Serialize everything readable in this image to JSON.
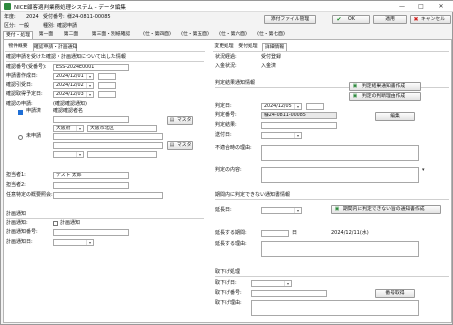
{
  "window": {
    "title": "NICE顧客適判業務処理システム - データ編集",
    "minimize": "—",
    "maximize": "□",
    "close": "✕"
  },
  "header": {
    "year_label": "年度:",
    "year_value": "2024",
    "ukeban_label": "受付番号:",
    "ukeban_value": "様24-0811-00085",
    "kubun_label": "区分:",
    "kubun_value": "一般",
    "shubetsu_label": "種別:",
    "shubetsu_value": "確認申請"
  },
  "toolbar": {
    "attach_label": "添付ファイル管理",
    "ok_label": "OK",
    "apply_label": "適用",
    "cancel_label": "キャンセル"
  },
  "tabs": [
    "受付・処理",
    "第一面",
    "第二面",
    "第三面・別紙確認",
    "(仕・第四面)",
    "(仕・第五面)",
    "(仕・第六面)",
    "(仕・第七面)"
  ],
  "left_subtabs": [
    "物件概要",
    "確認申請・計画通知"
  ],
  "right_subtabs": [
    "変更処理",
    "受付処理",
    "詳細情報"
  ],
  "left": {
    "section_title": "確認申請を受けた確認・計画通知について出した情報",
    "fields": [
      {
        "label": "確認番号(受番号):",
        "value": "ESS-2024E0001"
      },
      {
        "label": "申請書作成日:",
        "value": "2024/12/01"
      },
      {
        "label": "確認引受日:",
        "value": "2024/12/02"
      },
      {
        "label": "確認取得予定日:",
        "value": "2024/12/03"
      }
    ],
    "kakunin_label": "確認の申請:",
    "kakunin_sub_label": "(確認確認通知)",
    "applicant_check": "申請済",
    "applicant_name_label": "確認確認者名",
    "pref_value": "大阪府",
    "city_value": "大阪市北区",
    "master_label": "マスタ",
    "unapplied_check": "未申請",
    "master2_label": "マスタ",
    "tantou_label": "担当者1:",
    "tantou_value": "テスト 太郎",
    "tantou2_label": "担当者2:",
    "sonota_label": "任意特定の概要照会:"
  },
  "plan": {
    "section_title": "計画通知",
    "check_label": "計画通知:",
    "check_text": "計画通知",
    "num_label": "計画通知番号:",
    "date_label": "計画通知日:"
  },
  "right": {
    "status_label": "状況経過:",
    "status_value": "受付登録",
    "nyukin_label": "入金状況:",
    "nyukin_value": "入金済",
    "section1_title": "判定結果通知情報",
    "btn_result": "判定結果通知書作成",
    "btn_reason": "判定の判断理由作成",
    "hantei_date_label": "判定日:",
    "hantei_date_value": "2024/12/05",
    "hantei_num_label": "判定番号:",
    "hantei_num_value": "様24-0811-00085",
    "edit_label": "編集",
    "hantei_result_label": "判定結果:",
    "sofu_label": "送付日:",
    "futeki_label": "不適合時の理由:",
    "hantei_riyu_label": "判定の内容:",
    "section2_title": "期間内に判定できない通知書情報",
    "btn_notice": "期間内に判定できない旨の通知書作成",
    "enchou_label": "延長日:",
    "enchou_kikan_label": "延長する期間:",
    "enchou_kikan_unit": "日",
    "enchou_date_value": "2024/12/11(水)",
    "enchou_riyu_label": "延長する理由:",
    "section3_title": "取下げ処理",
    "torisage_date_label": "取下げ日:",
    "torisage_num_label": "取下げ番号:",
    "torisage_btn": "番号取得",
    "torisage_riyu_label": "取下げ理由:"
  }
}
